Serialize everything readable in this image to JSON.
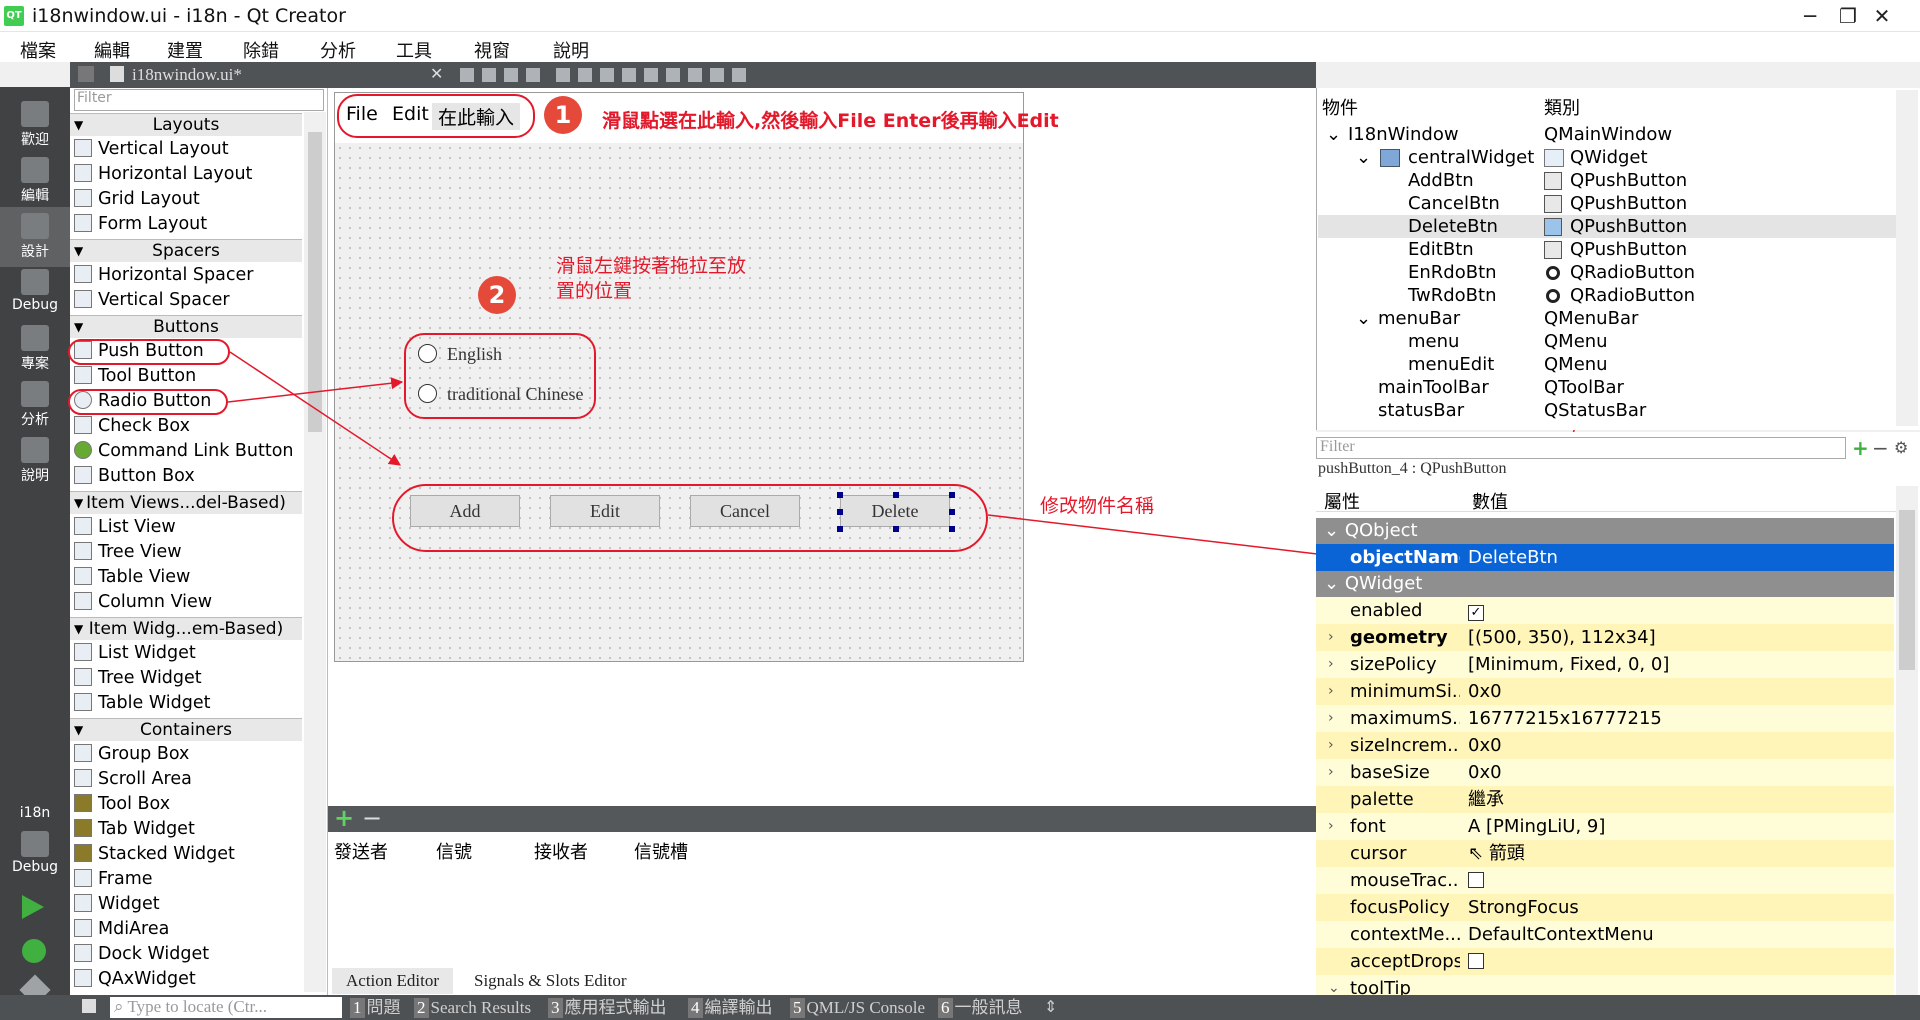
{
  "window": {
    "title": "i18nwindow.ui - i18n - Qt Creator",
    "app_icon": "QT",
    "controls": [
      "─",
      "❐",
      "✕"
    ]
  },
  "menubar": [
    "檔案",
    "編輯",
    "建置",
    "除錯",
    "分析",
    "工具",
    "視窗",
    "說明"
  ],
  "modes": [
    {
      "label": "歡迎",
      "icon": "welcome-icon"
    },
    {
      "label": "編輯",
      "icon": "edit-icon"
    },
    {
      "label": "設計",
      "icon": "design-icon"
    },
    {
      "label": "Debug",
      "icon": "debug-icon"
    },
    {
      "label": "專案",
      "icon": "projects-icon"
    },
    {
      "label": "分析",
      "icon": "analyze-icon"
    },
    {
      "label": "說明",
      "icon": "help-icon"
    }
  ],
  "kit": {
    "project": "i18n",
    "config": "Debug"
  },
  "editor_tab": {
    "filename": "i18nwindow.ui*",
    "close": "✕"
  },
  "widgetbox": {
    "filter_placeholder": "Filter",
    "categories": {
      "layouts": "Layouts",
      "spacers": "Spacers",
      "buttons": "Buttons",
      "item_views": "Item Views...del-Based)",
      "item_widgets": "Item Widg...em-Based)",
      "containers": "Containers"
    },
    "items": {
      "vertical_layout": "Vertical Layout",
      "horizontal_layout": "Horizontal Layout",
      "grid_layout": "Grid Layout",
      "form_layout": "Form Layout",
      "horizontal_spacer": "Horizontal Spacer",
      "vertical_spacer": "Vertical Spacer",
      "push_button": "Push Button",
      "tool_button": "Tool Button",
      "radio_button": "Radio Button",
      "check_box": "Check Box",
      "command_link_button": "Command Link Button",
      "button_box": "Button Box",
      "list_view": "List View",
      "tree_view": "Tree View",
      "table_view": "Table View",
      "column_view": "Column View",
      "list_widget": "List Widget",
      "tree_widget": "Tree Widget",
      "table_widget": "Table Widget",
      "group_box": "Group Box",
      "scroll_area": "Scroll Area",
      "tool_box": "Tool Box",
      "tab_widget": "Tab Widget",
      "stacked_widget": "Stacked Widget",
      "frame": "Frame",
      "widget": "Widget",
      "mdi_area": "MdiArea",
      "dock_widget": "Dock Widget",
      "qax_widget": "QAxWidget"
    }
  },
  "form": {
    "menu": {
      "file": "File",
      "edit": "Edit",
      "type_here": "在此輸入"
    },
    "radios": {
      "english": "English",
      "chinese": "traditional Chinese"
    },
    "buttons": {
      "add": "Add",
      "edit": "Edit",
      "cancel": "Cancel",
      "delete": "Delete"
    }
  },
  "annotations": {
    "step1_num": "1",
    "step1_text": "滑鼠點選在此輸入,然後輸入File Enter後再輸入Edit",
    "step2_num": "2",
    "step2_text_line1": "滑鼠左鍵按著拖拉至放",
    "step2_text_line2": "置的位置",
    "rename_text": "修改物件名稱"
  },
  "signals_editor": {
    "add": "+",
    "remove": "−",
    "columns": [
      "發送者",
      "信號",
      "接收者",
      "信號槽"
    ],
    "tabs": {
      "action_editor": "Action Editor",
      "signals_slots": "Signals & Slots Editor"
    }
  },
  "object_inspector": {
    "headers": {
      "object": "物件",
      "class": "類別"
    },
    "rows": {
      "window": {
        "name": "I18nWindow",
        "cls": "QMainWindow"
      },
      "central": {
        "name": "centralWidget",
        "cls": "QWidget"
      },
      "addbtn": {
        "name": "AddBtn",
        "cls": "QPushButton"
      },
      "cancelbtn": {
        "name": "CancelBtn",
        "cls": "QPushButton"
      },
      "deletebtn": {
        "name": "DeleteBtn",
        "cls": "QPushButton"
      },
      "editbtn": {
        "name": "EditBtn",
        "cls": "QPushButton"
      },
      "enrdobtn": {
        "name": "EnRdoBtn",
        "cls": "QRadioButton"
      },
      "twrdobtn": {
        "name": "TwRdoBtn",
        "cls": "QRadioButton"
      },
      "menubar": {
        "name": "menuBar",
        "cls": "QMenuBar"
      },
      "menu": {
        "name": "menu",
        "cls": "QMenu"
      },
      "menuedit": {
        "name": "menuEdit",
        "cls": "QMenu"
      },
      "toolbar": {
        "name": "mainToolBar",
        "cls": "QToolBar"
      },
      "statusbar": {
        "name": "statusBar",
        "cls": "QStatusBar"
      }
    }
  },
  "property_editor": {
    "filter_placeholder": "Filter",
    "class_label": "pushButton_4 : QPushButton",
    "headers": {
      "property": "屬性",
      "value": "數值"
    },
    "sections": {
      "qobject": "QObject",
      "qwidget": "QWidget"
    },
    "object_name": {
      "name": "objectName",
      "value": "DeleteBtn"
    },
    "props": {
      "enabled": {
        "name": "enabled",
        "value": ""
      },
      "geometry": {
        "name": "geometry",
        "value": "[(500, 350), 112x34]"
      },
      "sizePolicy": {
        "name": "sizePolicy",
        "value": "[Minimum, Fixed, 0, 0]"
      },
      "minimumSize": {
        "name": "minimumSi...",
        "value": "0x0"
      },
      "maximumSize": {
        "name": "maximumS...",
        "value": "16777215x16777215"
      },
      "sizeIncrement": {
        "name": "sizeIncrem...",
        "value": "0x0"
      },
      "baseSize": {
        "name": "baseSize",
        "value": "0x0"
      },
      "palette": {
        "name": "palette",
        "value": "繼承"
      },
      "font": {
        "name": "font",
        "value": "A  [PMingLiU, 9]"
      },
      "cursor": {
        "name": "cursor",
        "value": "箭頭"
      },
      "mouseTracking": {
        "name": "mouseTrac...",
        "value": ""
      },
      "focusPolicy": {
        "name": "focusPolicy",
        "value": "StrongFocus"
      },
      "contextMenu": {
        "name": "contextMe...",
        "value": "DefaultContextMenu"
      },
      "acceptDrops": {
        "name": "acceptDrops",
        "value": ""
      },
      "toolTip": {
        "name": "toolTip",
        "value": ""
      }
    }
  },
  "statusbar": {
    "locate_placeholder": "Type to locate (Ctr...",
    "tabs": [
      {
        "n": "1",
        "label": "問題"
      },
      {
        "n": "2",
        "label": "Search Results"
      },
      {
        "n": "3",
        "label": "應用程式輸出"
      },
      {
        "n": "4",
        "label": "編譯輸出"
      },
      {
        "n": "5",
        "label": "QML/JS Console"
      },
      {
        "n": "6",
        "label": "一般訊息"
      }
    ]
  },
  "colors": {
    "annotation_red": "#e3192b",
    "selection_blue": "#0a64d6",
    "property_yellow": "#fffcd8",
    "mode_bar": "#404244"
  }
}
